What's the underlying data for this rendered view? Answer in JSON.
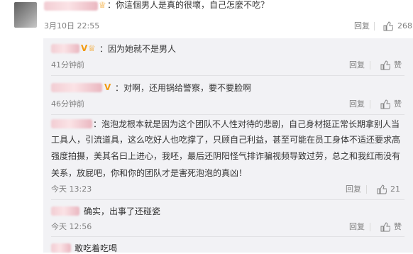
{
  "main_comment": {
    "text": "：你這個男人是真的很壞，自己怎麼不吃？",
    "time": "3月10日 22:55",
    "reply_label": "回复",
    "like_count": "268"
  },
  "replies": [
    {
      "text": "：因为她就不是男人",
      "time": "41分钟前",
      "reply_label": "回复",
      "like_count": "赞"
    },
    {
      "text": "：对啊，还用锅给警察，要不要脸啊",
      "time": "46分钟前",
      "reply_label": "回复",
      "like_count": "赞"
    },
    {
      "lines": [
        "：泡泡龙根本就是因为这个团队不人性对待的悲剧，自己身材挺正常长期拿别人当",
        "工具人，引流道具，这么吃好人也吃撑了，只顾自己利益，甚至可能在员工身体不适还要求高",
        "强度拍摄，美其名曰上进心，我呸，最后还阴阳怪气排诈骗视频导致过劳，总之和我红雨没有",
        "关系，放屁吧，你和你的团队才是害死泡泡的真凶！"
      ],
      "time": "今天 13:23",
      "reply_label": "回复",
      "like_count": "21"
    },
    {
      "text": "确实，出事了还碰瓷",
      "time": "今天 12:56",
      "reply_label": "回复",
      "like_count": "赞"
    },
    {
      "text": "敢吃着吃喝",
      "time": "",
      "reply_label": "",
      "like_count": ""
    }
  ],
  "icons": {
    "like": "thumbs-up-icon",
    "vip": "vip-badge-icon"
  },
  "colors": {
    "badge": "#f29b11",
    "reply_bg": "#f2f2f5",
    "meta": "#808080"
  }
}
